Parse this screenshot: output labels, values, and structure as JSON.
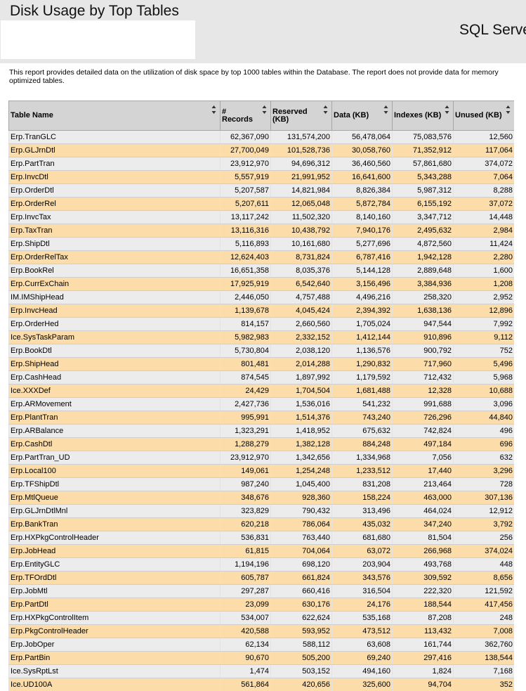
{
  "report": {
    "title": "Disk Usage by Top Tables",
    "product": "SQL Serve",
    "description": "This report provides detailed data on the utilization of disk space by top 1000 tables within the Database. The report does not provide data for memory optimized tables."
  },
  "colors": {
    "header_band": "#e7e7e7",
    "column_header": "#d4d4d4",
    "row_odd": "#ececec",
    "row_even": "#fcdca8"
  },
  "table": {
    "columns": [
      {
        "label": "Table Name",
        "align": "left"
      },
      {
        "label": "# Records",
        "align": "right"
      },
      {
        "label": "Reserved (KB)",
        "align": "right"
      },
      {
        "label": "Data (KB)",
        "align": "right"
      },
      {
        "label": "Indexes (KB)",
        "align": "right"
      },
      {
        "label": "Unused (KB)",
        "align": "right"
      }
    ],
    "sort_icon": "sort-arrows-icon",
    "rows": [
      [
        "Erp.TranGLC",
        "62,367,090",
        "131,574,200",
        "56,478,064",
        "75,083,576",
        "12,560"
      ],
      [
        "Erp.GLJrnDtl",
        "27,700,049",
        "101,528,736",
        "30,058,760",
        "71,352,912",
        "117,064"
      ],
      [
        "Erp.PartTran",
        "23,912,970",
        "94,696,312",
        "36,460,560",
        "57,861,680",
        "374,072"
      ],
      [
        "Erp.InvcDtl",
        "5,557,919",
        "21,991,952",
        "16,641,600",
        "5,343,288",
        "7,064"
      ],
      [
        "Erp.OrderDtl",
        "5,207,587",
        "14,821,984",
        "8,826,384",
        "5,987,312",
        "8,288"
      ],
      [
        "Erp.OrderRel",
        "5,207,611",
        "12,065,048",
        "5,872,784",
        "6,155,192",
        "37,072"
      ],
      [
        "Erp.InvcTax",
        "13,117,242",
        "11,502,320",
        "8,140,160",
        "3,347,712",
        "14,448"
      ],
      [
        "Erp.TaxTran",
        "13,116,316",
        "10,438,792",
        "7,940,176",
        "2,495,632",
        "2,984"
      ],
      [
        "Erp.ShipDtl",
        "5,116,893",
        "10,161,680",
        "5,277,696",
        "4,872,560",
        "11,424"
      ],
      [
        "Erp.OrderRelTax",
        "12,624,403",
        "8,731,824",
        "6,787,416",
        "1,942,128",
        "2,280"
      ],
      [
        "Erp.BookRel",
        "16,651,358",
        "8,035,376",
        "5,144,128",
        "2,889,648",
        "1,600"
      ],
      [
        "Erp.CurrExChain",
        "17,925,919",
        "6,542,640",
        "3,156,496",
        "3,384,936",
        "1,208"
      ],
      [
        "IM.IMShipHead",
        "2,446,050",
        "4,757,488",
        "4,496,216",
        "258,320",
        "2,952"
      ],
      [
        "Erp.InvcHead",
        "1,139,678",
        "4,045,424",
        "2,394,392",
        "1,638,136",
        "12,896"
      ],
      [
        "Erp.OrderHed",
        "814,157",
        "2,660,560",
        "1,705,024",
        "947,544",
        "7,992"
      ],
      [
        "Ice.SysTaskParam",
        "5,982,983",
        "2,332,152",
        "1,412,144",
        "910,896",
        "9,112"
      ],
      [
        "Erp.BookDtl",
        "5,730,804",
        "2,038,120",
        "1,136,576",
        "900,792",
        "752"
      ],
      [
        "Erp.ShipHead",
        "801,481",
        "2,014,288",
        "1,290,832",
        "717,960",
        "5,496"
      ],
      [
        "Erp.CashHead",
        "874,545",
        "1,897,992",
        "1,179,592",
        "712,432",
        "5,968"
      ],
      [
        "Ice.XXXDef",
        "24,429",
        "1,704,504",
        "1,681,488",
        "12,328",
        "10,688"
      ],
      [
        "Erp.ARMovement",
        "2,427,736",
        "1,536,016",
        "541,232",
        "991,688",
        "3,096"
      ],
      [
        "Erp.PlantTran",
        "995,991",
        "1,514,376",
        "743,240",
        "726,296",
        "44,840"
      ],
      [
        "Erp.ARBalance",
        "1,323,291",
        "1,418,952",
        "675,632",
        "742,824",
        "496"
      ],
      [
        "Erp.CashDtl",
        "1,288,279",
        "1,382,128",
        "884,248",
        "497,184",
        "696"
      ],
      [
        "Erp.PartTran_UD",
        "23,912,970",
        "1,342,656",
        "1,334,968",
        "7,056",
        "632"
      ],
      [
        "Erp.Local100",
        "149,061",
        "1,254,248",
        "1,233,512",
        "17,440",
        "3,296"
      ],
      [
        "Erp.TFShipDtl",
        "987,240",
        "1,045,400",
        "831,208",
        "213,464",
        "728"
      ],
      [
        "Erp.MtlQueue",
        "348,676",
        "928,360",
        "158,224",
        "463,000",
        "307,136"
      ],
      [
        "Erp.GLJrnDtlMnl",
        "323,829",
        "790,432",
        "313,496",
        "464,024",
        "12,912"
      ],
      [
        "Erp.BankTran",
        "620,218",
        "786,064",
        "435,032",
        "347,240",
        "3,792"
      ],
      [
        "Erp.HXPkgControlHeader",
        "536,831",
        "763,440",
        "681,680",
        "81,504",
        "256"
      ],
      [
        "Erp.JobHead",
        "61,815",
        "704,064",
        "63,072",
        "266,968",
        "374,024"
      ],
      [
        "Erp.EntityGLC",
        "1,194,196",
        "698,120",
        "203,904",
        "493,768",
        "448"
      ],
      [
        "Erp.TFOrdDtl",
        "605,787",
        "661,824",
        "343,576",
        "309,592",
        "8,656"
      ],
      [
        "Erp.JobMtl",
        "297,287",
        "660,416",
        "316,504",
        "222,320",
        "121,592"
      ],
      [
        "Erp.PartDtl",
        "23,099",
        "630,176",
        "24,176",
        "188,544",
        "417,456"
      ],
      [
        "Erp.HXPkgControlItem",
        "534,007",
        "622,624",
        "535,168",
        "87,208",
        "248"
      ],
      [
        "Erp.PkgControlHeader",
        "420,588",
        "593,952",
        "473,512",
        "113,432",
        "7,008"
      ],
      [
        "Erp.JobOper",
        "62,134",
        "588,112",
        "63,608",
        "161,744",
        "362,760"
      ],
      [
        "Erp.PartBin",
        "90,670",
        "505,200",
        "69,240",
        "297,416",
        "138,544"
      ],
      [
        "Ice.SysRptLst",
        "1,474",
        "503,152",
        "494,160",
        "1,824",
        "7,168"
      ],
      [
        "Ice.UD100A",
        "561,864",
        "420,656",
        "325,600",
        "94,704",
        "352"
      ]
    ]
  }
}
